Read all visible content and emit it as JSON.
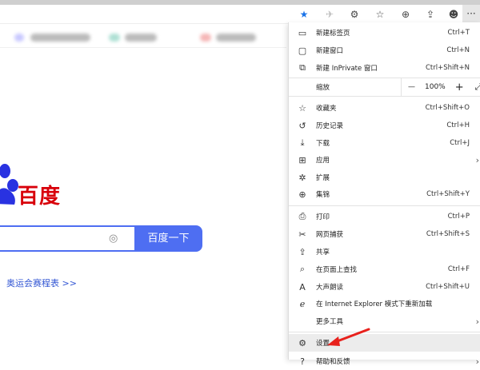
{
  "toolbar": {
    "icons": [
      "favorite-star-icon",
      "extension-puzzle-icon",
      "extensions-icon",
      "favorites-icon",
      "collections-icon",
      "share-icon",
      "profile-avatar-icon"
    ],
    "more": "···"
  },
  "baidu": {
    "logo_text": "百度",
    "search_button": "百度一下",
    "hot_link": "奥运会赛程表 >>"
  },
  "menu": {
    "items": [
      {
        "label": "新建标签页",
        "shortcut": "Ctrl+T"
      },
      {
        "label": "新建窗口",
        "shortcut": "Ctrl+N"
      },
      {
        "label": "新建 InPrivate 窗口",
        "shortcut": "Ctrl+Shift+N"
      }
    ],
    "zoom": {
      "label": "缩放",
      "minus": "—",
      "value": "100%",
      "plus": "+"
    },
    "items2": [
      {
        "label": "收藏夹",
        "shortcut": "Ctrl+Shift+O"
      },
      {
        "label": "历史记录",
        "shortcut": "Ctrl+H"
      },
      {
        "label": "下载",
        "shortcut": "Ctrl+J"
      },
      {
        "label": "应用",
        "shortcut": ""
      },
      {
        "label": "扩展",
        "shortcut": ""
      },
      {
        "label": "集锦",
        "shortcut": "Ctrl+Shift+Y"
      }
    ],
    "items3": [
      {
        "label": "打印",
        "shortcut": "Ctrl+P"
      },
      {
        "label": "网页捕获",
        "shortcut": "Ctrl+Shift+S"
      },
      {
        "label": "共享",
        "shortcut": ""
      },
      {
        "label": "在页面上查找",
        "shortcut": "Ctrl+F"
      },
      {
        "label": "大声朗读",
        "shortcut": "Ctrl+Shift+U"
      },
      {
        "label": "在 Internet Explorer 模式下重新加载",
        "shortcut": ""
      },
      {
        "label": "更多工具",
        "shortcut": ""
      }
    ],
    "settings": "设置",
    "help": "帮助和反馈"
  }
}
